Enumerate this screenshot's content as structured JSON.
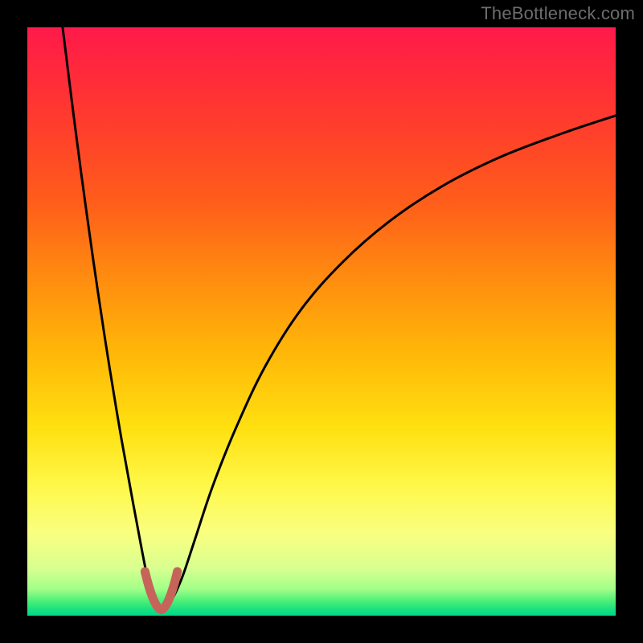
{
  "watermark": "TheBottleneck.com",
  "gradient": {
    "stops": [
      {
        "offset": 0.0,
        "color": "#ff1a4a"
      },
      {
        "offset": 0.08,
        "color": "#ff2a3a"
      },
      {
        "offset": 0.18,
        "color": "#ff402a"
      },
      {
        "offset": 0.3,
        "color": "#ff5e1a"
      },
      {
        "offset": 0.42,
        "color": "#ff8a10"
      },
      {
        "offset": 0.55,
        "color": "#ffb608"
      },
      {
        "offset": 0.68,
        "color": "#ffe010"
      },
      {
        "offset": 0.78,
        "color": "#fff84a"
      },
      {
        "offset": 0.86,
        "color": "#f9ff80"
      },
      {
        "offset": 0.92,
        "color": "#d8ff90"
      },
      {
        "offset": 0.955,
        "color": "#a0ff88"
      },
      {
        "offset": 0.975,
        "color": "#4cf078"
      },
      {
        "offset": 0.99,
        "color": "#18e082"
      },
      {
        "offset": 1.0,
        "color": "#00d887"
      }
    ]
  },
  "chart_data": {
    "type": "line",
    "title": "",
    "xlabel": "",
    "ylabel": "",
    "xlim": [
      0,
      100
    ],
    "ylim": [
      0,
      100
    ],
    "series": [
      {
        "name": "left-branch",
        "x": [
          6.0,
          8.0,
          10.0,
          12.0,
          14.0,
          16.0,
          18.0,
          19.5,
          20.5,
          21.3,
          22.0
        ],
        "y": [
          100.0,
          84.0,
          69.0,
          55.0,
          42.0,
          30.0,
          19.0,
          11.0,
          6.0,
          3.0,
          2.0
        ]
      },
      {
        "name": "right-branch",
        "x": [
          24.0,
          25.0,
          26.5,
          28.5,
          31.5,
          35.5,
          40.5,
          46.5,
          53.5,
          61.5,
          70.5,
          80.5,
          91.0,
          100.0
        ],
        "y": [
          2.0,
          3.5,
          7.0,
          13.0,
          22.0,
          32.0,
          42.5,
          52.0,
          60.0,
          67.0,
          73.0,
          78.0,
          82.0,
          85.0
        ]
      }
    ],
    "trough_marker": {
      "x_range": [
        20.0,
        25.5
      ],
      "y_range": [
        1.0,
        7.5
      ],
      "color": "#c66459"
    }
  }
}
